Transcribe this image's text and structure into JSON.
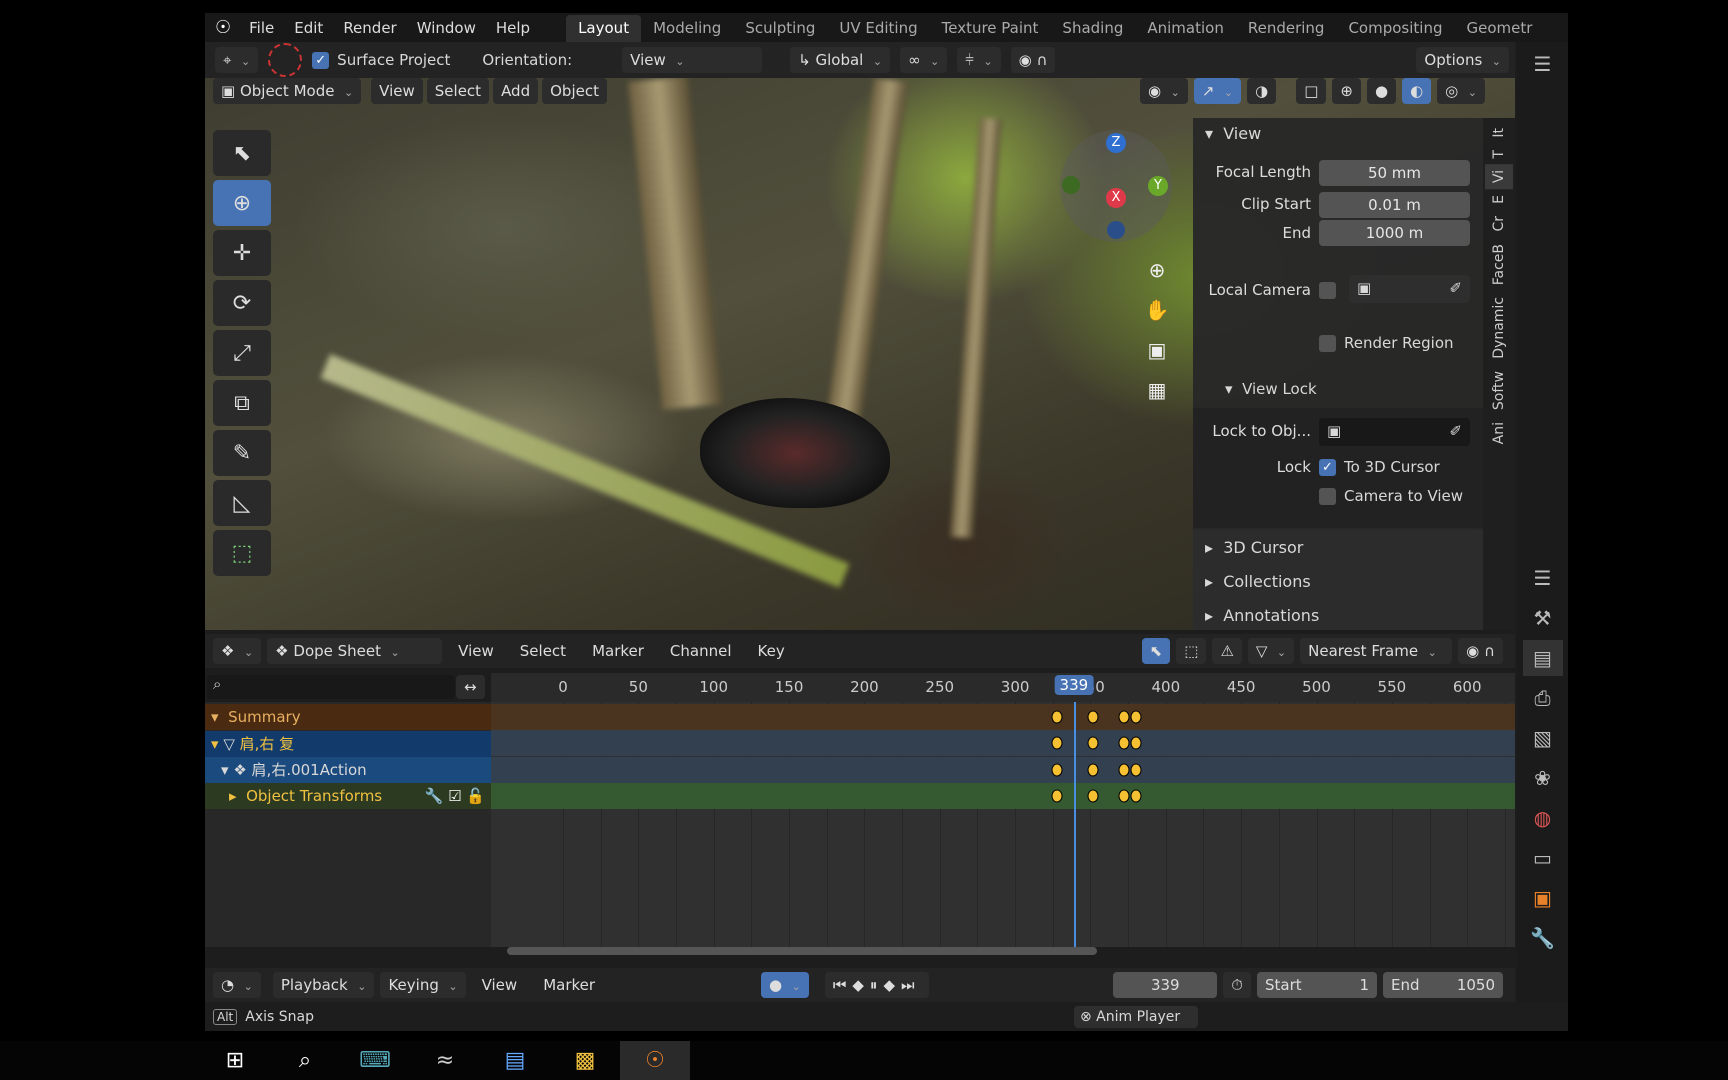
{
  "menu": {
    "items": [
      "File",
      "Edit",
      "Render",
      "Window",
      "Help"
    ]
  },
  "workspaces": [
    {
      "label": "Layout",
      "active": true
    },
    {
      "label": "Modeling"
    },
    {
      "label": "Sculpting"
    },
    {
      "label": "UV Editing"
    },
    {
      "label": "Texture Paint"
    },
    {
      "label": "Shading"
    },
    {
      "label": "Animation"
    },
    {
      "label": "Rendering"
    },
    {
      "label": "Compositing"
    },
    {
      "label": "Geometr"
    }
  ],
  "tool_header": {
    "surface_project": "Surface Project",
    "orientation_label": "Orientation:",
    "orientation_value": "View",
    "transform": "Global",
    "options": "Options"
  },
  "viewport_header": {
    "mode": "Object Mode",
    "menus": [
      "View",
      "Select",
      "Add",
      "Object"
    ]
  },
  "gizmo": {
    "z": "Z",
    "x": "X",
    "y": "Y"
  },
  "npanel": {
    "view_title": "View",
    "focal_length_label": "Focal Length",
    "focal_length": "50 mm",
    "clip_start_label": "Clip Start",
    "clip_start": "0.01 m",
    "end_label": "End",
    "clip_end": "1000 m",
    "local_camera": "Local Camera",
    "render_region": "Render Region",
    "view_lock_title": "View Lock",
    "lock_to_obj": "Lock to Obj...",
    "lock_label": "Lock",
    "to_3d_cursor": "To 3D Cursor",
    "to_3d_cursor_checked": true,
    "camera_to_view": "Camera to View",
    "collapsed": [
      "3D Cursor",
      "Collections",
      "Annotations"
    ],
    "tabs": [
      "It",
      "T",
      "Vi",
      "E",
      "Cr",
      "FaceB",
      "Dynamic",
      "Softw",
      "Ani"
    ]
  },
  "dopesheet": {
    "editor": "Dope Sheet",
    "menus": [
      "View",
      "Select",
      "Marker",
      "Channel",
      "Key"
    ],
    "snap": "Nearest Frame",
    "current_frame": "339",
    "ticks": [
      "0",
      "50",
      "100",
      "150",
      "200",
      "250",
      "300",
      "350",
      "400",
      "450",
      "500",
      "550",
      "600"
    ],
    "channels": [
      {
        "label": "Summary",
        "color": "#4a2a10",
        "text": "#e8b060"
      },
      {
        "label": "肩,右 复",
        "color": "#123a6a",
        "text": "#f0c040"
      },
      {
        "label": "肩,右.001Action",
        "color": "#1b4a7e",
        "text": "#d8d8d8"
      },
      {
        "label": "Object Transforms",
        "color": "#2c4a22",
        "text": "#f0c040"
      }
    ],
    "keyframes": [
      328,
      352,
      372,
      380
    ],
    "row_bg": [
      "#4a3420",
      "#334050",
      "#334050",
      "#355a32"
    ]
  },
  "timeline": {
    "menus": [
      "Playback",
      "Keying",
      "View",
      "Marker"
    ],
    "frame": "339",
    "start_label": "Start",
    "start": "1",
    "end_label": "End",
    "end": "1050"
  },
  "status": {
    "key": "Alt",
    "hint": "Axis Snap",
    "anim_player": "Anim Player"
  },
  "colors": {
    "accent": "#4772b3",
    "keyframe": "#f5c032"
  }
}
